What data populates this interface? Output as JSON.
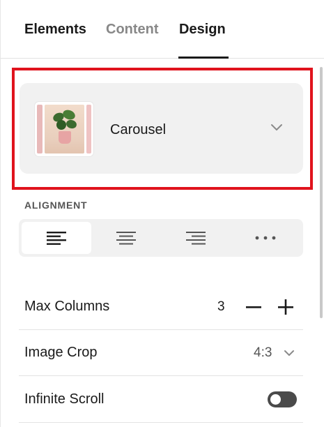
{
  "tabs": [
    {
      "label": "Elements",
      "active": false
    },
    {
      "label": "Content",
      "active": false
    },
    {
      "label": "Design",
      "active": true
    }
  ],
  "layout": {
    "selected_label": "Carousel",
    "thumbnail_icon": "carousel-plant-thumbnail"
  },
  "alignment": {
    "section_label": "ALIGNMENT",
    "options": [
      "align-left",
      "align-center",
      "align-right",
      "more"
    ],
    "selected": "align-left"
  },
  "settings": {
    "max_columns": {
      "label": "Max Columns",
      "value": "3"
    },
    "image_crop": {
      "label": "Image Crop",
      "value": "4:3"
    },
    "infinite_scroll": {
      "label": "Infinite Scroll",
      "enabled": false
    }
  },
  "colors": {
    "highlight": "#e0131d",
    "card_bg": "#f1f1f1",
    "toggle_off": "#4a4a4a"
  }
}
